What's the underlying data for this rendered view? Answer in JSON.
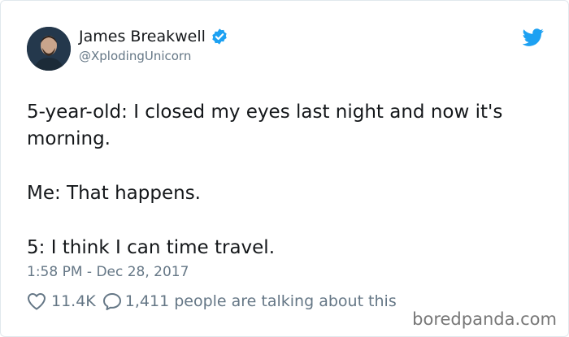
{
  "author": {
    "name": "James Breakwell",
    "handle": "@XplodingUnicorn"
  },
  "tweet": {
    "lines": [
      "5-year-old: I closed my eyes last night and now it's morning.",
      "Me: That happens.",
      "5: I think I can time travel."
    ],
    "timestamp": "1:58 PM - Dec 28, 2017"
  },
  "engagement": {
    "likes": "11.4K",
    "talking": "1,411 people are talking about this"
  },
  "watermark": "boredpanda.com",
  "colors": {
    "accent": "#1da1f2",
    "text": "#14171a",
    "muted": "#657786"
  },
  "icons": {
    "verified": "verified-badge-icon",
    "bird": "twitter-bird-icon",
    "heart": "heart-icon",
    "reply": "speech-bubble-icon"
  }
}
